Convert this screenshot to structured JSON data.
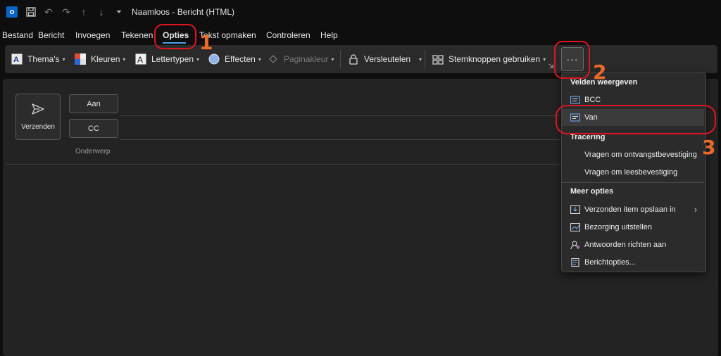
{
  "window": {
    "title": "Naamloos  -  Bericht (HTML)"
  },
  "menu_tabs": [
    "Bestand",
    "Bericht",
    "Invoegen",
    "Tekenen",
    "Opties",
    "Tekst opmaken",
    "Controleren",
    "Help"
  ],
  "active_tab": "Opties",
  "ribbon": {
    "themes": "Thema's",
    "colors": "Kleuren",
    "fonts": "Lettertypen",
    "effects": "Effecten",
    "page_color": "Paginakleur",
    "encrypt": "Versleutelen",
    "voting": "Stemknoppen gebruiken",
    "more": "···"
  },
  "compose": {
    "send": "Verzenden",
    "to": "Aan",
    "cc": "CC",
    "subject": "Onderwerp"
  },
  "dropdown": {
    "section_fields": "Velden weergeven",
    "bcc": "BCC",
    "from": "Van",
    "section_tracking": "Tracering",
    "delivery_receipt": "Vragen om ontvangstbevestiging",
    "read_receipt": "Vragen om leesbevestiging",
    "section_more": "Meer opties",
    "save_sent": "Verzonden item opslaan in",
    "delay_delivery": "Bezorging uitstellen",
    "direct_replies": "Antwoorden richten aan",
    "message_options": "Berichtopties..."
  },
  "annotations": {
    "step1": "1",
    "step2": "2",
    "step3": "3"
  },
  "colors": {
    "accent": "#4a9fe8",
    "annotation_ring": "#e0141e",
    "annotation_number": "#ea6a2a"
  }
}
